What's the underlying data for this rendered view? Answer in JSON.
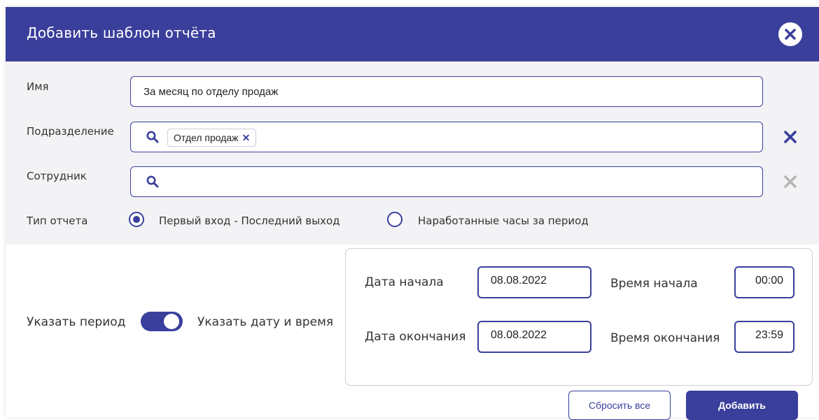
{
  "dialog": {
    "title": "Добавить шаблон отчёта",
    "close_icon": "close-icon"
  },
  "form": {
    "name": {
      "label": "Имя",
      "value": "За месяц по отделу продаж"
    },
    "department": {
      "label": "Подразделение",
      "tag": "Отдел продаж",
      "icons": [
        "search-icon",
        "remove-tag-icon",
        "clear-icon"
      ]
    },
    "employee": {
      "label": "Сотрудник",
      "value": "",
      "icons": [
        "search-icon",
        "clear-icon"
      ]
    },
    "report_type": {
      "label": "Тип отчета",
      "options": [
        {
          "label": "Первый вход - Последний выход",
          "selected": true
        },
        {
          "label": "Наработанные часы за период",
          "selected": false
        }
      ]
    }
  },
  "period": {
    "left_label": "Указать период",
    "right_label": "Указать дату и время",
    "toggle_on": true
  },
  "dates": {
    "start_date_label": "Дата начала",
    "start_date": "08.08.2022",
    "start_time_label": "Время начала",
    "start_time": "00:00",
    "end_date_label": "Дата окончания",
    "end_date": "08.08.2022",
    "end_time_label": "Время окончания",
    "end_time": "23:59"
  },
  "actions": {
    "reset": "Сбросить все",
    "add": "Добавить"
  },
  "colors": {
    "accent": "#3a3f9c",
    "panel_bg": "#f3f3f6",
    "disabled": "#b5b5b5"
  }
}
